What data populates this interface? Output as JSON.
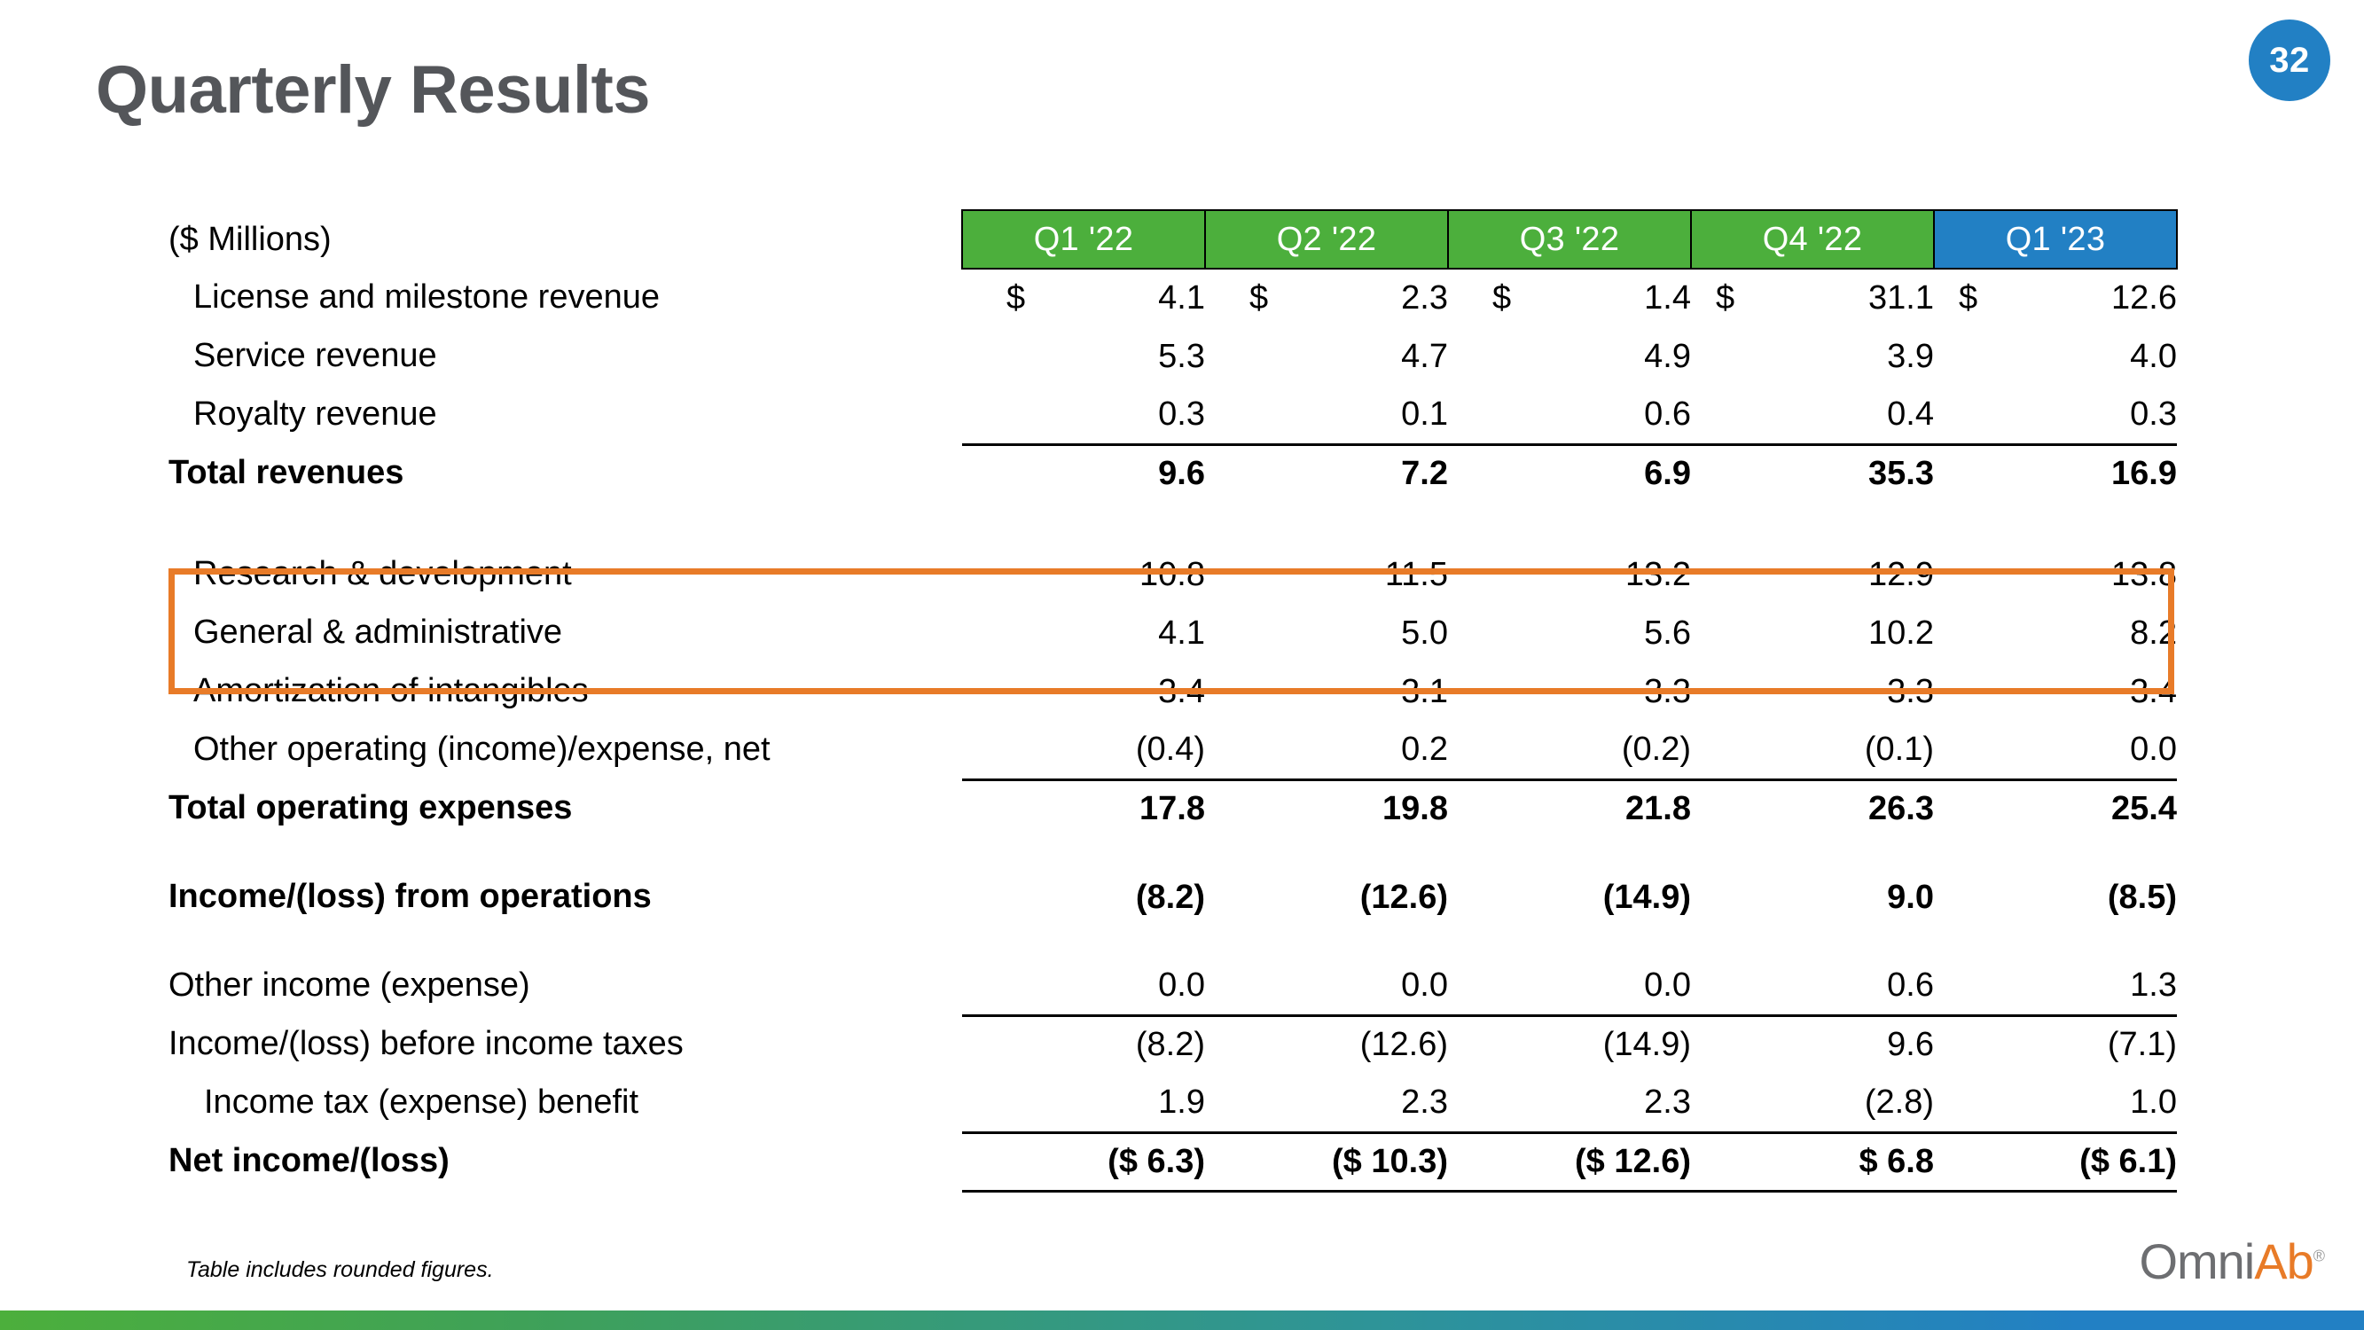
{
  "page": {
    "number": "32",
    "title": "Quarterly Results",
    "footnote": "Table includes rounded figures.",
    "accent_green": "#4CAF3C",
    "accent_blue": "#2280C4",
    "accent_orange": "#E87B28",
    "title_color": "#54565A"
  },
  "logo": {
    "part1": "Omni",
    "part2": "Ab",
    "trademark": "®"
  },
  "table": {
    "unit_label": "($ Millions)",
    "columns": [
      {
        "label": "Q1 '22",
        "current": false
      },
      {
        "label": "Q2 '22",
        "current": false
      },
      {
        "label": "Q3 '22",
        "current": false
      },
      {
        "label": "Q4 '22",
        "current": false
      },
      {
        "label": "Q1 '23",
        "current": true
      }
    ],
    "rows": [
      {
        "label": "License and milestone revenue",
        "values": [
          "4.1",
          "2.3",
          "1.4",
          "31.1",
          "12.6"
        ],
        "currency": [
          "$",
          "$",
          "$",
          "$",
          "$"
        ]
      },
      {
        "label": "Service revenue",
        "values": [
          "5.3",
          "4.7",
          "4.9",
          "3.9",
          "4.0"
        ]
      },
      {
        "label": "Royalty revenue",
        "values": [
          "0.3",
          "0.1",
          "0.6",
          "0.4",
          "0.3"
        ]
      },
      {
        "label": "Total revenues",
        "values": [
          "9.6",
          "7.2",
          "6.9",
          "35.3",
          "16.9"
        ]
      },
      {
        "label": "Research & development",
        "values": [
          "10.8",
          "11.5",
          "13.2",
          "12.9",
          "13.8"
        ]
      },
      {
        "label": "General & administrative",
        "values": [
          "4.1",
          "5.0",
          "5.6",
          "10.2",
          "8.2"
        ]
      },
      {
        "label": "Amortization of intangibles",
        "values": [
          "3.4",
          "3.1",
          "3.3",
          "3.3",
          "3.4"
        ]
      },
      {
        "label": "Other operating (income)/expense, net",
        "values": [
          "(0.4)",
          "0.2",
          "(0.2)",
          "(0.1)",
          "0.0"
        ]
      },
      {
        "label": "Total operating expenses",
        "values": [
          "17.8",
          "19.8",
          "21.8",
          "26.3",
          "25.4"
        ]
      },
      {
        "label": "Income/(loss) from operations",
        "values": [
          "(8.2)",
          "(12.6)",
          "(14.9)",
          "9.0",
          "(8.5)"
        ]
      },
      {
        "label": "Other income (expense)",
        "values": [
          "0.0",
          "0.0",
          "0.0",
          "0.6",
          "1.3"
        ]
      },
      {
        "label": "Income/(loss) before income taxes",
        "values": [
          "(8.2)",
          "(12.6)",
          "(14.9)",
          "9.6",
          "(7.1)"
        ]
      },
      {
        "label": "Income tax (expense) benefit",
        "values": [
          "1.9",
          "2.3",
          "2.3",
          "(2.8)",
          "1.0"
        ]
      },
      {
        "label": "Net income/(loss)",
        "values": [
          "($  6.3)",
          "($  10.3)",
          "($  12.6)",
          "$  6.8",
          "($  6.1)"
        ]
      }
    ]
  }
}
